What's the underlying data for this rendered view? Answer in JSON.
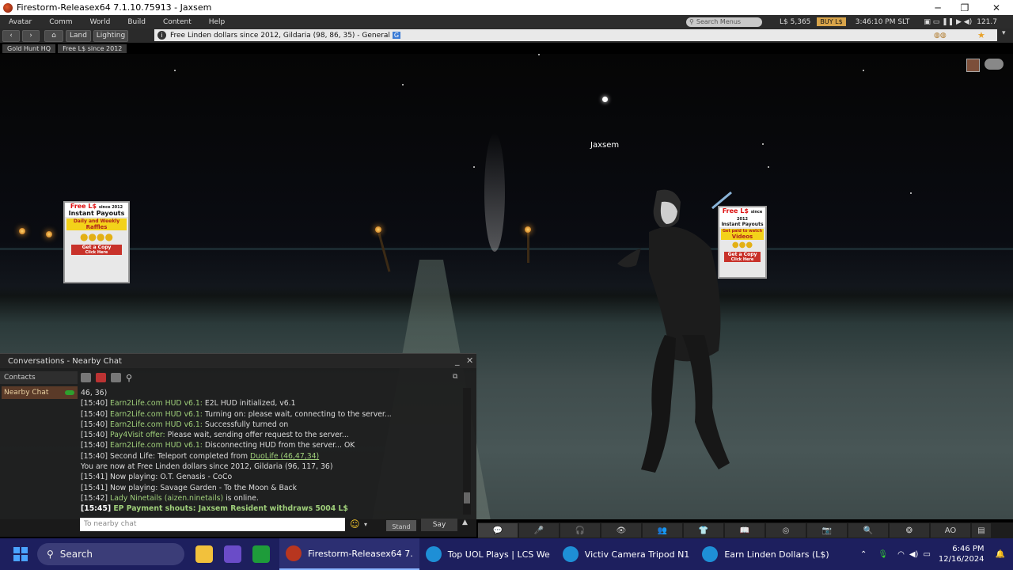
{
  "window": {
    "title": "Firestorm-Releasex64 7.1.10.75913 - Jaxsem",
    "minimize": "─",
    "maximize": "❐",
    "close": "✕"
  },
  "menubar": {
    "items": [
      "Avatar",
      "Comm",
      "World",
      "Build",
      "Content",
      "Help"
    ],
    "search_placeholder": "Search Menus",
    "balance": "L$ 5,365",
    "buy_label": "BUY L$",
    "time": "3:46:10 PM SLT",
    "fps": "121.7"
  },
  "navbar": {
    "back": "‹",
    "forward": "›",
    "home": "⌂",
    "land_label": "Land",
    "lighting_label": "Lighting",
    "location": "Free Linden dollars since 2012, Gildaria (98, 86, 35) - General",
    "rating_badge": "G",
    "star": "★"
  },
  "favorites": [
    "Gold Hunt HQ",
    "Free L$ since 2012"
  ],
  "scene": {
    "avatar_name": "Jaxsem",
    "sign_left": {
      "top_red": "Free L$",
      "top_small": "since 2012",
      "title": "Instant Payouts",
      "band1": "Daily and Weekly",
      "band2": "Raffles",
      "cta": "Get a Copy",
      "cta2": "Click Here"
    },
    "sign_right": {
      "top_red": "Free L$",
      "top_small": "since 2012",
      "title": "Instant Payouts",
      "band1": "Get paid to watch",
      "band2": "Videos",
      "cta": "Get a Copy",
      "cta2": "Click Here"
    }
  },
  "conversations": {
    "title": "Conversations - Nearby Chat",
    "contacts_label": "Contacts",
    "nearby_label": "Nearby Chat",
    "lines": [
      {
        "ts": "",
        "src": "",
        "text": "46, 36)"
      },
      {
        "ts": "[15:40]",
        "src": "Earn2Life.com HUD v6.1:",
        "text": " E2L HUD initialized, v6.1"
      },
      {
        "ts": "[15:40]",
        "src": "Earn2Life.com HUD v6.1:",
        "text": " Turning on: please wait, connecting to the server..."
      },
      {
        "ts": "[15:40]",
        "src": "Earn2Life.com HUD v6.1:",
        "text": " Successfully turned on"
      },
      {
        "ts": "[15:40]",
        "src": "Pay4Visit offer:",
        "text": " Please wait, sending offer request to the server..."
      },
      {
        "ts": "[15:40]",
        "src": "Earn2Life.com HUD v6.1:",
        "text": " Disconnecting HUD from the server... OK"
      },
      {
        "ts": "[15:40]",
        "src": "",
        "text": "Second Life: Teleport completed from ",
        "link": "DuoLife (46,47,34)"
      },
      {
        "ts": "",
        "src": "",
        "text": "You are now at Free Linden dollars since 2012, Gildaria (96, 117, 36)"
      },
      {
        "ts": "[15:41]",
        "src": "",
        "text": "Now playing: O.T. Genasis - CoCo"
      },
      {
        "ts": "[15:41]",
        "src": "",
        "text": "Now playing: Savage Garden - To the Moon & Back"
      },
      {
        "ts": "[15:42]",
        "src": "Lady Ninetails (aizen.ninetails)",
        "text": " is online."
      }
    ],
    "shout": {
      "ts": "[15:45]",
      "text": " EP Payment shouts: Jaxsem Resident withdraws 5004 L$"
    },
    "input_placeholder": "To nearby chat",
    "stand_label": "Stand",
    "say_label": "Say"
  },
  "bottombar": [
    "💬",
    "🎤",
    "🎧",
    "👁",
    "👥",
    "👕",
    "📖",
    "◎",
    "📷",
    "🔍",
    "❂",
    "AO",
    "▤"
  ],
  "taskbar": {
    "search_label": "Search",
    "tasks": [
      {
        "label": "Firestorm-Releasex64 7.",
        "color": "#b8361f"
      },
      {
        "label": "Top UOL Plays | LCS We",
        "color": "#1e8fd6"
      },
      {
        "label": "Victiv Camera Tripod N1",
        "color": "#1e8fd6"
      },
      {
        "label": "Earn Linden Dollars (L$)",
        "color": "#1e8fd6"
      }
    ],
    "time": "6:46 PM",
    "date": "12/16/2024"
  }
}
